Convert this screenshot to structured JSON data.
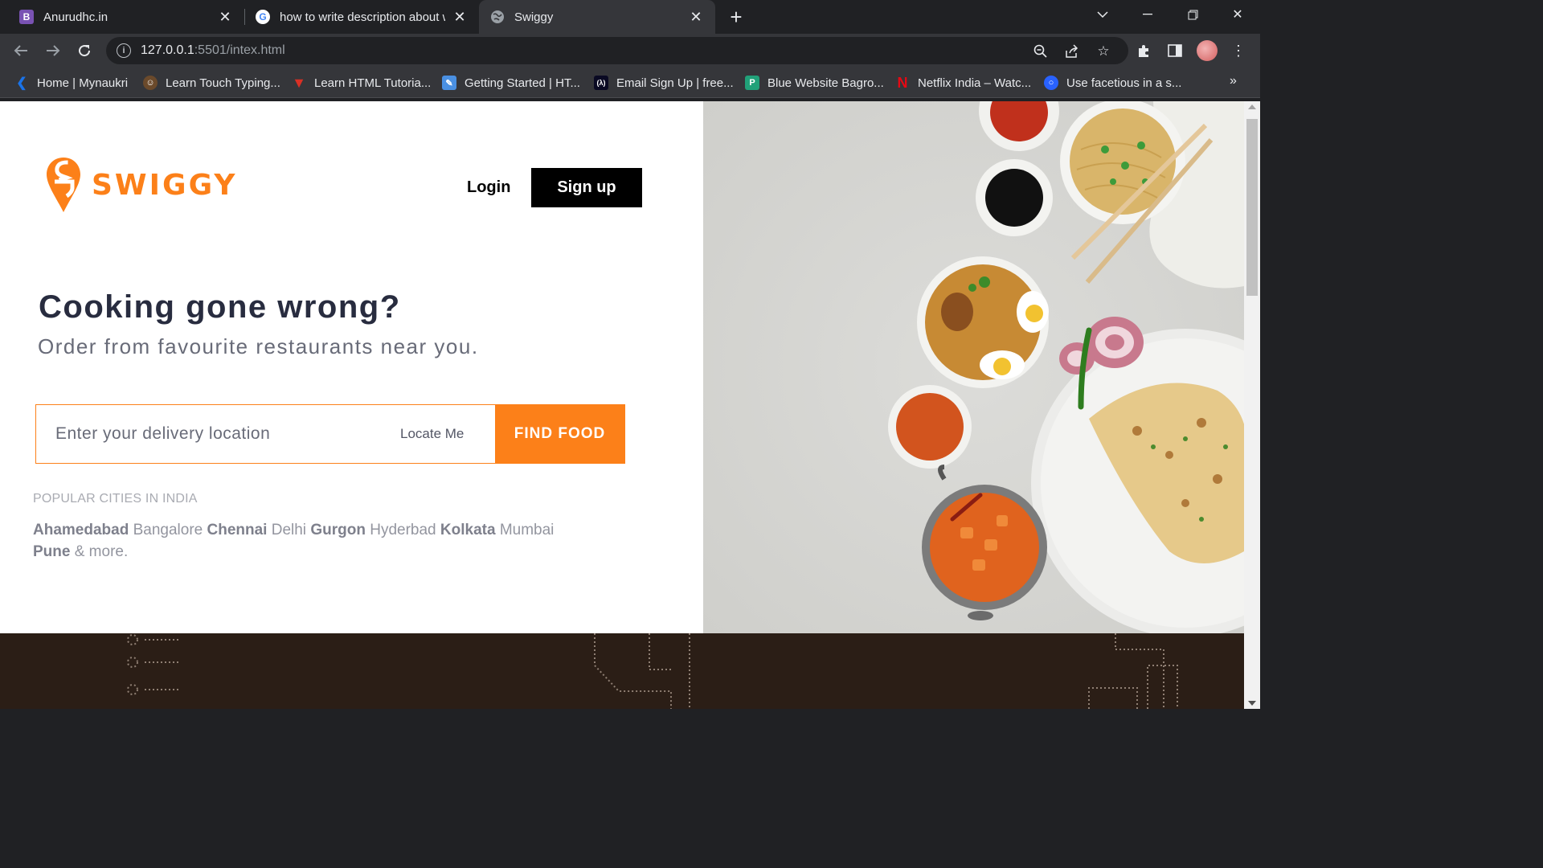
{
  "browser": {
    "tabs": [
      {
        "title": "Anurudhc.in",
        "favicon": "B",
        "favicon_color": "#7952b3",
        "active": false
      },
      {
        "title": "how to write description about w",
        "favicon": "G",
        "favicon_color": "#ffffff",
        "active": false
      },
      {
        "title": "Swiggy",
        "favicon": "globe-icon",
        "favicon_color": "#9aa0a6",
        "active": true
      }
    ],
    "url_host": "127.0.0.1",
    "url_rest": ":5501/intex.html",
    "bookmarks": [
      {
        "label": "Home | Mynaukri",
        "icon": "mynaukri-icon",
        "color": "#1a73e8"
      },
      {
        "label": "Learn Touch Typing...",
        "icon": "typing-icon",
        "color": "#e8a23b"
      },
      {
        "label": "Learn HTML Tutoria...",
        "icon": "tutorial-icon",
        "color": "#d93025"
      },
      {
        "label": "Getting Started | HT...",
        "icon": "getting-started-icon",
        "color": "#4a90e2"
      },
      {
        "label": "Email Sign Up | free...",
        "icon": "freecodecamp-icon",
        "color": "#0a0a23"
      },
      {
        "label": "Blue Website Bagro...",
        "icon": "blue-website-icon",
        "color": "#21a179"
      },
      {
        "label": "Netflix India – Watc...",
        "icon": "netflix-icon",
        "color": "#e50914"
      },
      {
        "label": "Use facetious in a s...",
        "icon": "facetious-icon",
        "color": "#2962ff"
      }
    ],
    "bookmarks_more": "»"
  },
  "page": {
    "brand": "SWIGGY",
    "brand_color": "#fc8019",
    "login_label": "Login",
    "signup_label": "Sign up",
    "headline": "Cooking gone wrong?",
    "subline": "Order from favourite restaurants near you.",
    "search_placeholder": "Enter your delivery location",
    "locate_label": "Locate Me",
    "find_food_label": "FIND FOOD",
    "cities_title": "POPULAR CITIES IN INDIA",
    "cities": [
      {
        "name": "Ahamedabad",
        "bold": true
      },
      {
        "name": "Bangalore",
        "bold": false
      },
      {
        "name": "Chennai",
        "bold": true
      },
      {
        "name": "Delhi",
        "bold": false
      },
      {
        "name": "Gurgon",
        "bold": true
      },
      {
        "name": "Hyderbad",
        "bold": false
      },
      {
        "name": "Kolkata",
        "bold": true
      },
      {
        "name": "Mumbai",
        "bold": false
      },
      {
        "name": "Pune",
        "bold": true
      }
    ],
    "cities_more": "& more."
  }
}
